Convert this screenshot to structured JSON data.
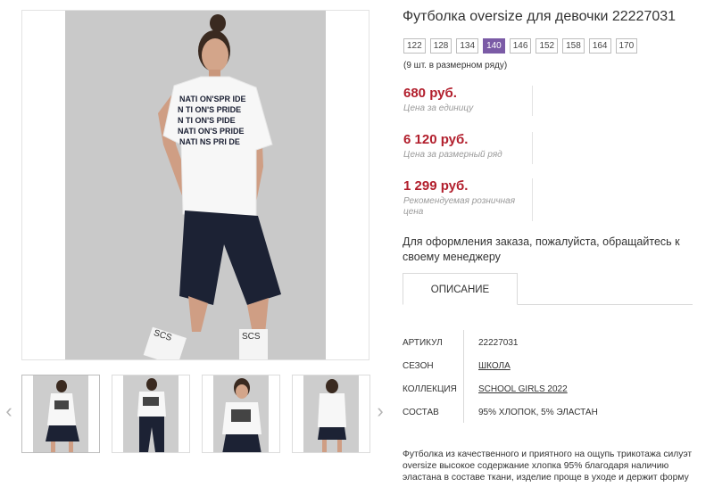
{
  "product": {
    "title": "Футболка oversize для девочки 22227031",
    "sizes": [
      "122",
      "128",
      "134",
      "140",
      "146",
      "152",
      "158",
      "164",
      "170"
    ],
    "selected_size": "140",
    "size_note": "(9 шт. в размерном ряду)"
  },
  "prices": [
    {
      "value": "680 руб.",
      "label": "Цена за единицу"
    },
    {
      "value": "6 120 руб.",
      "label": "Цена за размерный ряд"
    },
    {
      "value": "1 299 руб.",
      "label": "Рекомендуемая розничная цена"
    }
  ],
  "order_note": "Для оформления заказа, пожалуйста, обращайтесь к своему менеджеру",
  "tabs": {
    "description": "ОПИСАНИЕ"
  },
  "specs": [
    {
      "key": "АРТИКУЛ",
      "value": "22227031"
    },
    {
      "key": "СЕЗОН",
      "value": "ШКОЛА"
    },
    {
      "key": "КОЛЛЕКЦИЯ",
      "value": "SCHOOL GIRLS 2022"
    },
    {
      "key": "СОСТАВ",
      "value": "95% ХЛОПОК, 5% ЭЛАСТАН"
    }
  ],
  "description": "Футболка из качественного и приятного на ощупь трикотажа силуэт oversize высокое содержание хлопка 95% благодаря наличию эластана в составе ткани, изделие проще в уходе и держит форму",
  "gallery": {
    "shirt_print": [
      "NATI ON'SPR IDE",
      "N TI ON'S PRIDE",
      "N TI ON'S PIDE",
      "NATI ON'S PRIDE",
      "NATI NS PRI DE"
    ],
    "sock_text": "SCS",
    "thumbnails": [
      {
        "name": "front-shorts"
      },
      {
        "name": "front-trousers"
      },
      {
        "name": "closeup-shorts"
      },
      {
        "name": "back-shorts"
      }
    ]
  },
  "colors": {
    "accent": "#7b5ba6",
    "price": "#b21f2d",
    "shorts": "#1c2234",
    "shirt": "#ffffff",
    "backdrop": "#c9c9c9"
  }
}
